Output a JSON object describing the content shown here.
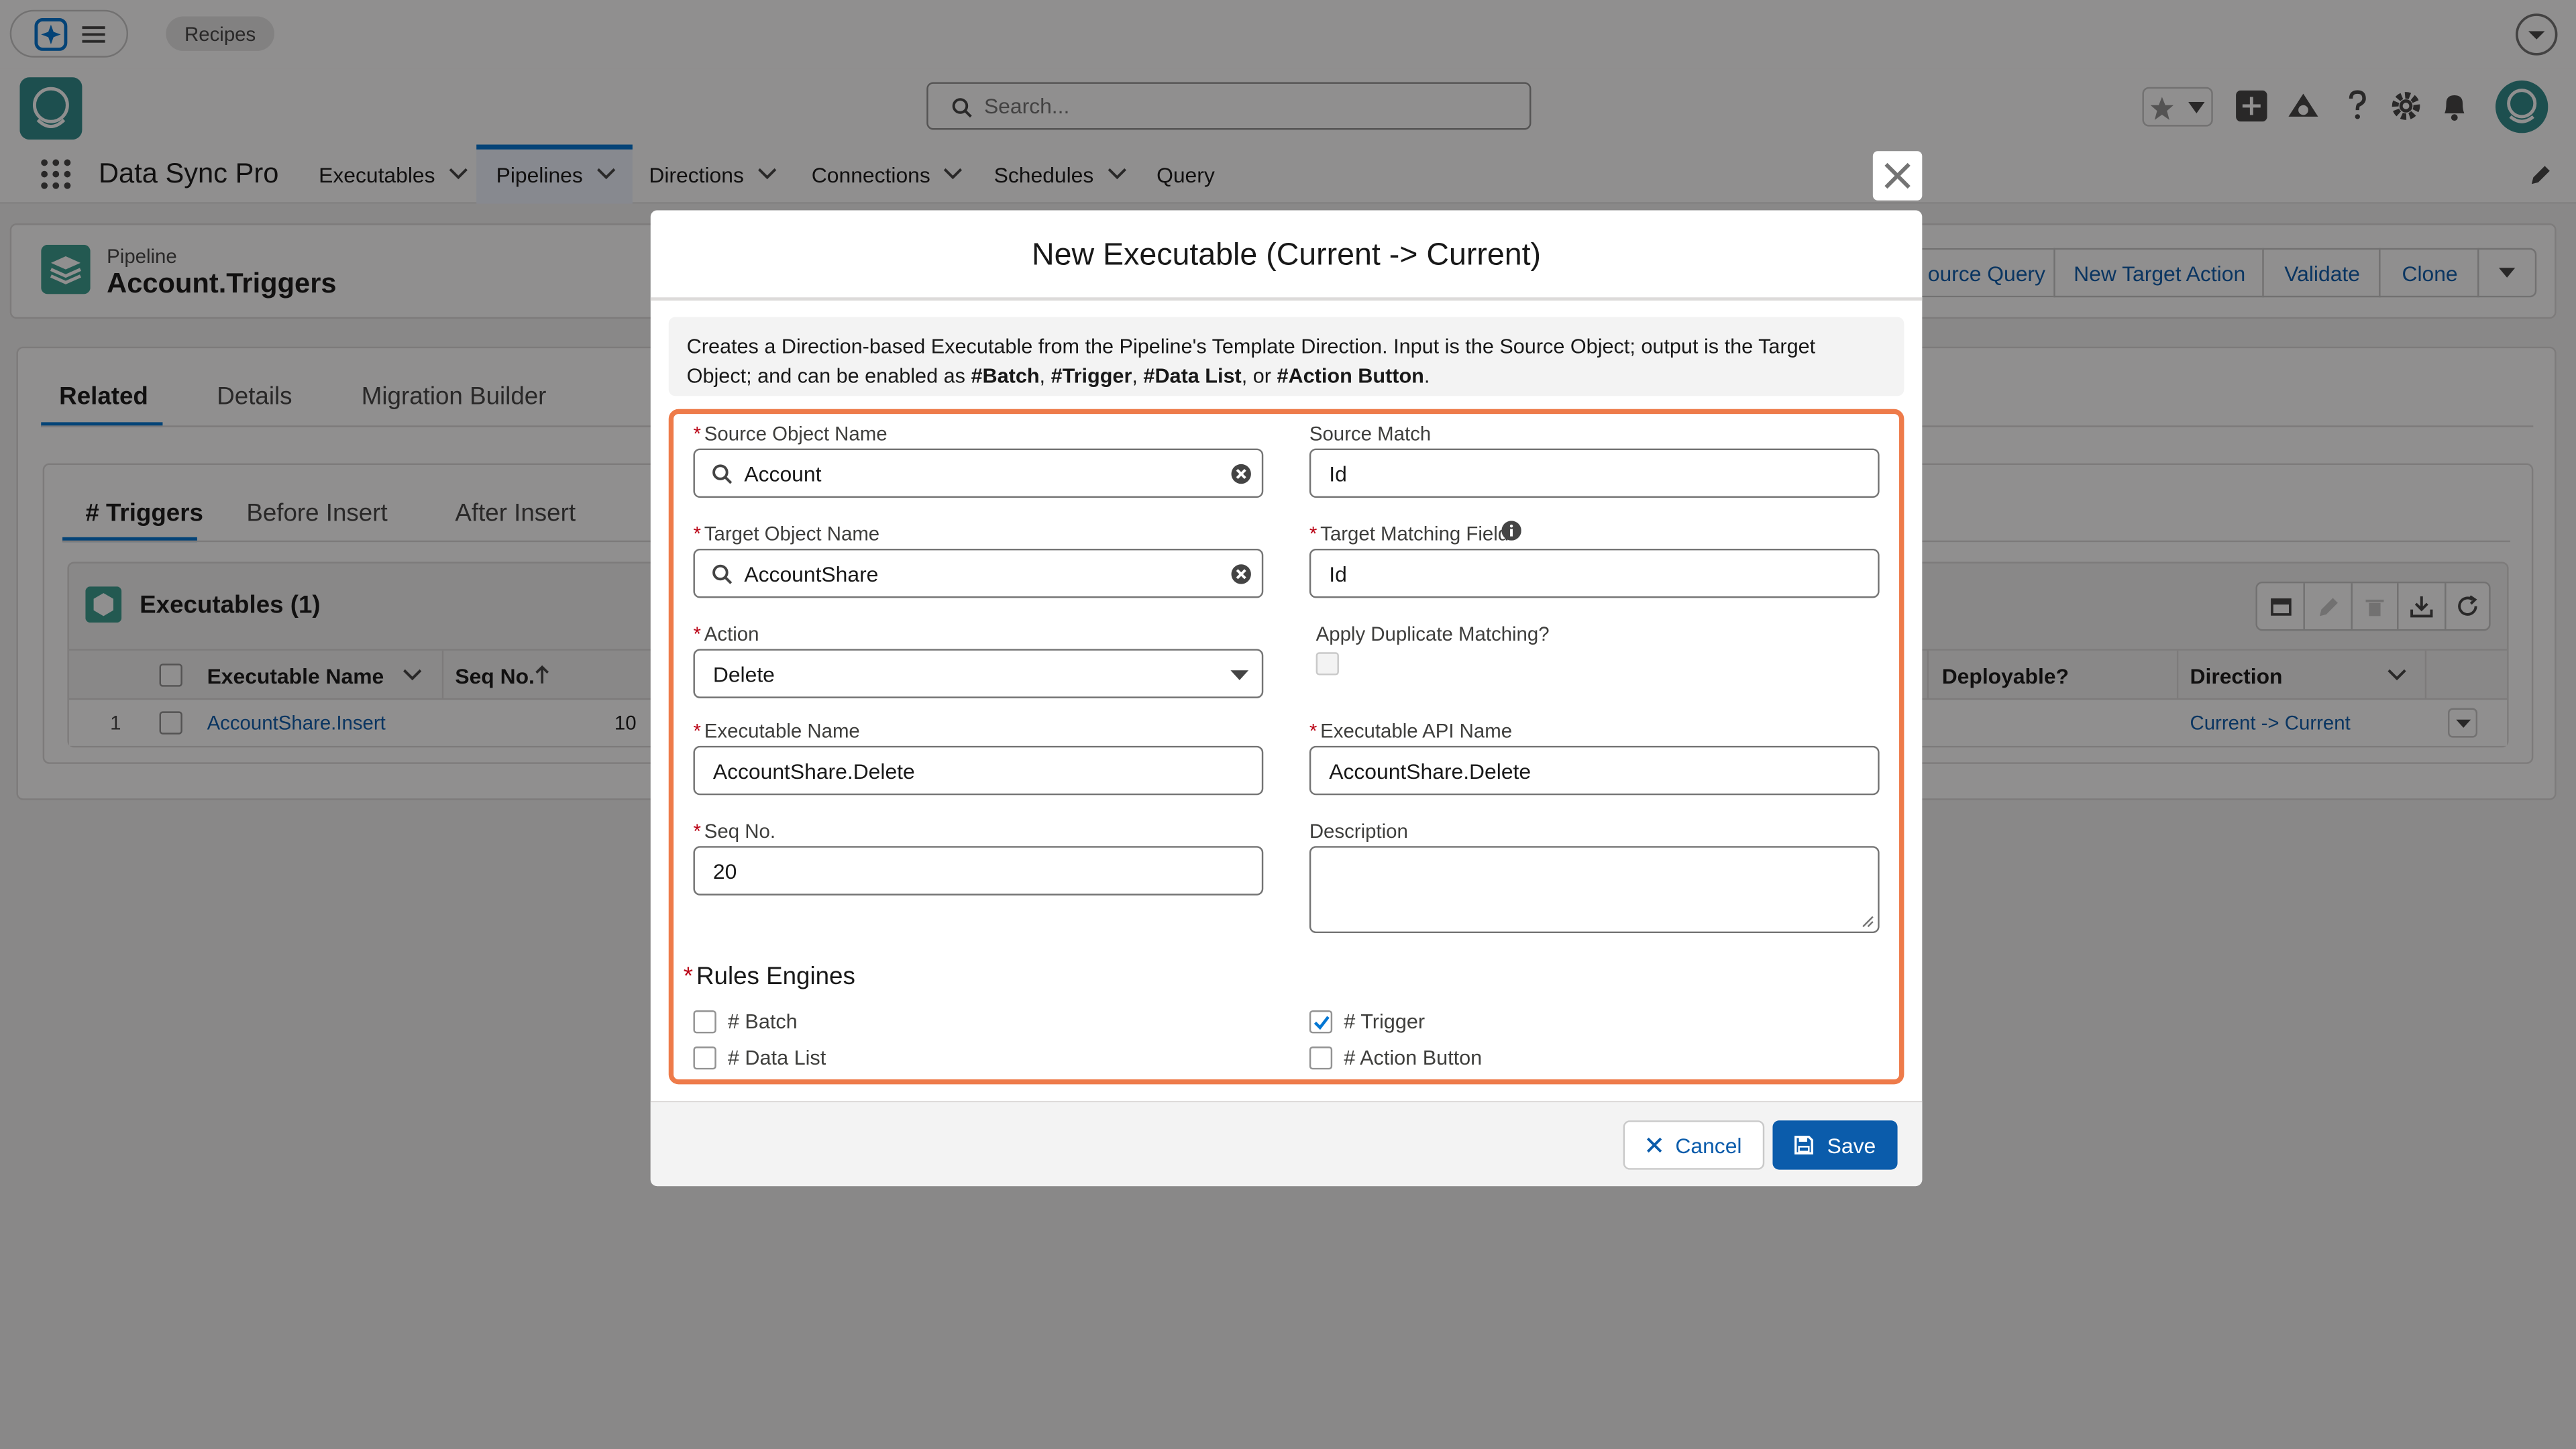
{
  "topbar": {
    "recipes_label": "Recipes"
  },
  "header": {
    "search_placeholder": "Search..."
  },
  "nav": {
    "app_name": "Data Sync Pro",
    "items": [
      {
        "label": "Executables"
      },
      {
        "label": "Pipelines"
      },
      {
        "label": "Directions"
      },
      {
        "label": "Connections"
      },
      {
        "label": "Schedules"
      },
      {
        "label": "Query"
      }
    ]
  },
  "record": {
    "object_label": "Pipeline",
    "title": "Account.Triggers",
    "actions": [
      "ource Query",
      "New Target Action",
      "Validate",
      "Clone"
    ]
  },
  "tabs": [
    "Related",
    "Details",
    "Migration Builder"
  ],
  "subtabs": [
    "# Triggers",
    "Before Insert",
    "After Insert"
  ],
  "related_list": {
    "title": "Executables (1)",
    "columns": [
      "Executable Name",
      "Seq No.",
      "Deployable?",
      "Direction"
    ],
    "rows": [
      {
        "num": "1",
        "name": "AccountShare.Insert",
        "seq": "10",
        "direction": "Current -> Current"
      }
    ]
  },
  "modal": {
    "title": "New Executable (Current -> Current)",
    "info_text": "Creates a Direction-based Executable from the Pipeline's Template Direction. Input is the Source Object; output is the Target Object; and can be enabled as ",
    "info_batch": "#Batch",
    "info_sep1": ", ",
    "info_trigger": "#Trigger",
    "info_sep2": ", ",
    "info_datalist": "#Data List",
    "info_or": ", or ",
    "info_action": "#Action Button",
    "info_end": ".",
    "required_marker": "*",
    "fields": {
      "source_object_label": "Source Object Name",
      "source_object_value": "Account",
      "source_match_label": "Source Match",
      "source_match_value": "Id",
      "target_object_label": "Target Object Name",
      "target_object_value": "AccountShare",
      "target_match_label": "Target Matching Field",
      "target_match_value": "Id",
      "action_label": "Action",
      "action_value": "Delete",
      "dup_label": "Apply Duplicate Matching?",
      "exec_name_label": "Executable Name",
      "exec_name_value": "AccountShare.Delete",
      "api_name_label": "Executable API Name",
      "api_name_value": "AccountShare.Delete",
      "seq_label": "Seq No.",
      "seq_value": "20",
      "desc_label": "Description",
      "desc_value": ""
    },
    "rules_title": "Rules Engines",
    "rules": [
      {
        "label": "# Batch",
        "checked": false
      },
      {
        "label": "# Trigger",
        "checked": true
      },
      {
        "label": "# Data List",
        "checked": false
      },
      {
        "label": "# Action Button",
        "checked": false
      }
    ],
    "cancel_label": "Cancel",
    "save_label": "Save"
  },
  "colors": {
    "brand": "#0176d3",
    "save_button": "#0b5cab",
    "highlight_border": "#ee7b4a",
    "link": "#0b5cab"
  }
}
